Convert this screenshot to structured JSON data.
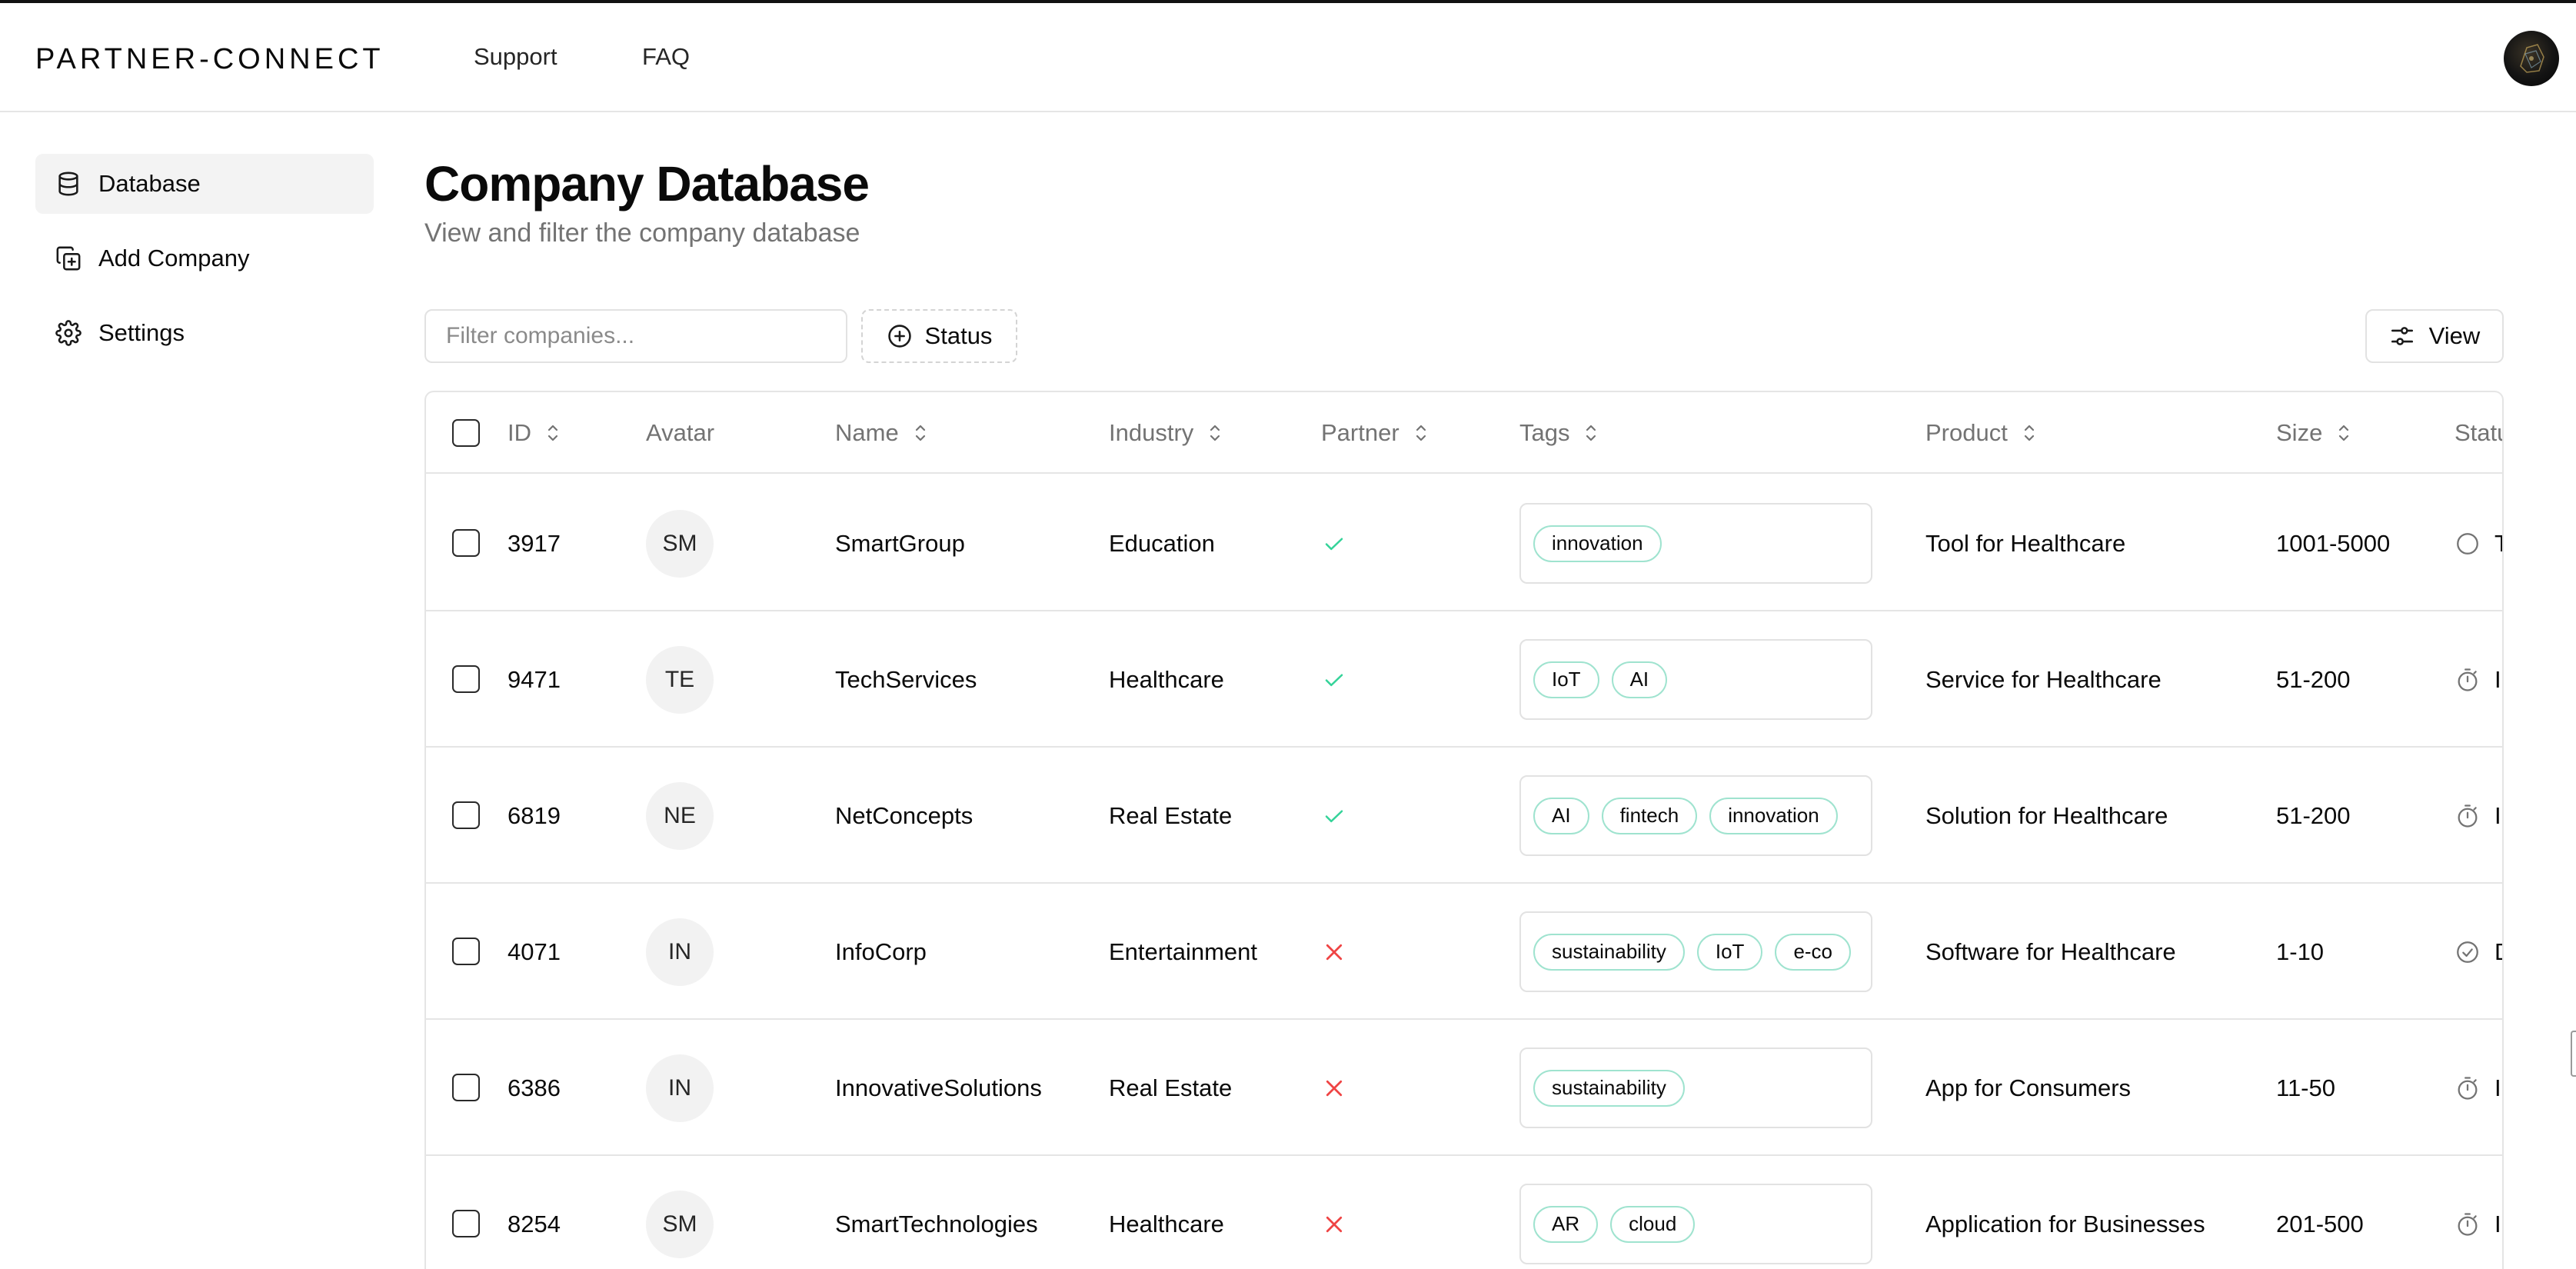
{
  "header": {
    "brand": "PARTNER-CONNECT",
    "nav": [
      {
        "label": "Support"
      },
      {
        "label": "FAQ"
      }
    ]
  },
  "sidebar": {
    "items": [
      {
        "label": "Database",
        "icon": "database-icon",
        "active": true
      },
      {
        "label": "Add Company",
        "icon": "copy-plus-icon",
        "active": false
      },
      {
        "label": "Settings",
        "icon": "gear-icon",
        "active": false
      }
    ]
  },
  "page": {
    "title": "Company Database",
    "subtitle": "View and filter the company database"
  },
  "toolbar": {
    "filter_placeholder": "Filter companies...",
    "filter_value": "",
    "status_label": "Status",
    "view_label": "View"
  },
  "table": {
    "columns": [
      "ID",
      "Avatar",
      "Name",
      "Industry",
      "Partner",
      "Tags",
      "Product",
      "Size",
      "Statu"
    ],
    "rows": [
      {
        "id": "3917",
        "avatar": "SM",
        "name": "SmartGroup",
        "industry": "Education",
        "partner": true,
        "tags": [
          "innovation"
        ],
        "product": "Tool for Healthcare",
        "size": "1001-5000",
        "status_icon": "circle-icon",
        "status_text": "T"
      },
      {
        "id": "9471",
        "avatar": "TE",
        "name": "TechServices",
        "industry": "Healthcare",
        "partner": true,
        "tags": [
          "IoT",
          "AI"
        ],
        "product": "Service for Healthcare",
        "size": "51-200",
        "status_icon": "timer-icon",
        "status_text": "I"
      },
      {
        "id": "6819",
        "avatar": "NE",
        "name": "NetConcepts",
        "industry": "Real Estate",
        "partner": true,
        "tags": [
          "AI",
          "fintech",
          "innovation"
        ],
        "product": "Solution for Healthcare",
        "size": "51-200",
        "status_icon": "timer-icon",
        "status_text": "I"
      },
      {
        "id": "4071",
        "avatar": "IN",
        "name": "InfoCorp",
        "industry": "Entertainment",
        "partner": false,
        "tags": [
          "sustainability",
          "IoT",
          "e-co"
        ],
        "product": "Software for Healthcare",
        "size": "1-10",
        "status_icon": "check-circle-icon",
        "status_text": "D"
      },
      {
        "id": "6386",
        "avatar": "IN",
        "name": "InnovativeSolutions",
        "industry": "Real Estate",
        "partner": false,
        "tags": [
          "sustainability"
        ],
        "product": "App for Consumers",
        "size": "11-50",
        "status_icon": "timer-icon",
        "status_text": "I"
      },
      {
        "id": "8254",
        "avatar": "SM",
        "name": "SmartTechnologies",
        "industry": "Healthcare",
        "partner": false,
        "tags": [
          "AR",
          "cloud"
        ],
        "product": "Application for Businesses",
        "size": "201-500",
        "status_icon": "timer-icon",
        "status_text": "I"
      }
    ]
  },
  "colors": {
    "partner_yes": "#34d399",
    "partner_no": "#ef4444",
    "tag_border": "#9fe3cf",
    "muted_text": "#737373"
  }
}
